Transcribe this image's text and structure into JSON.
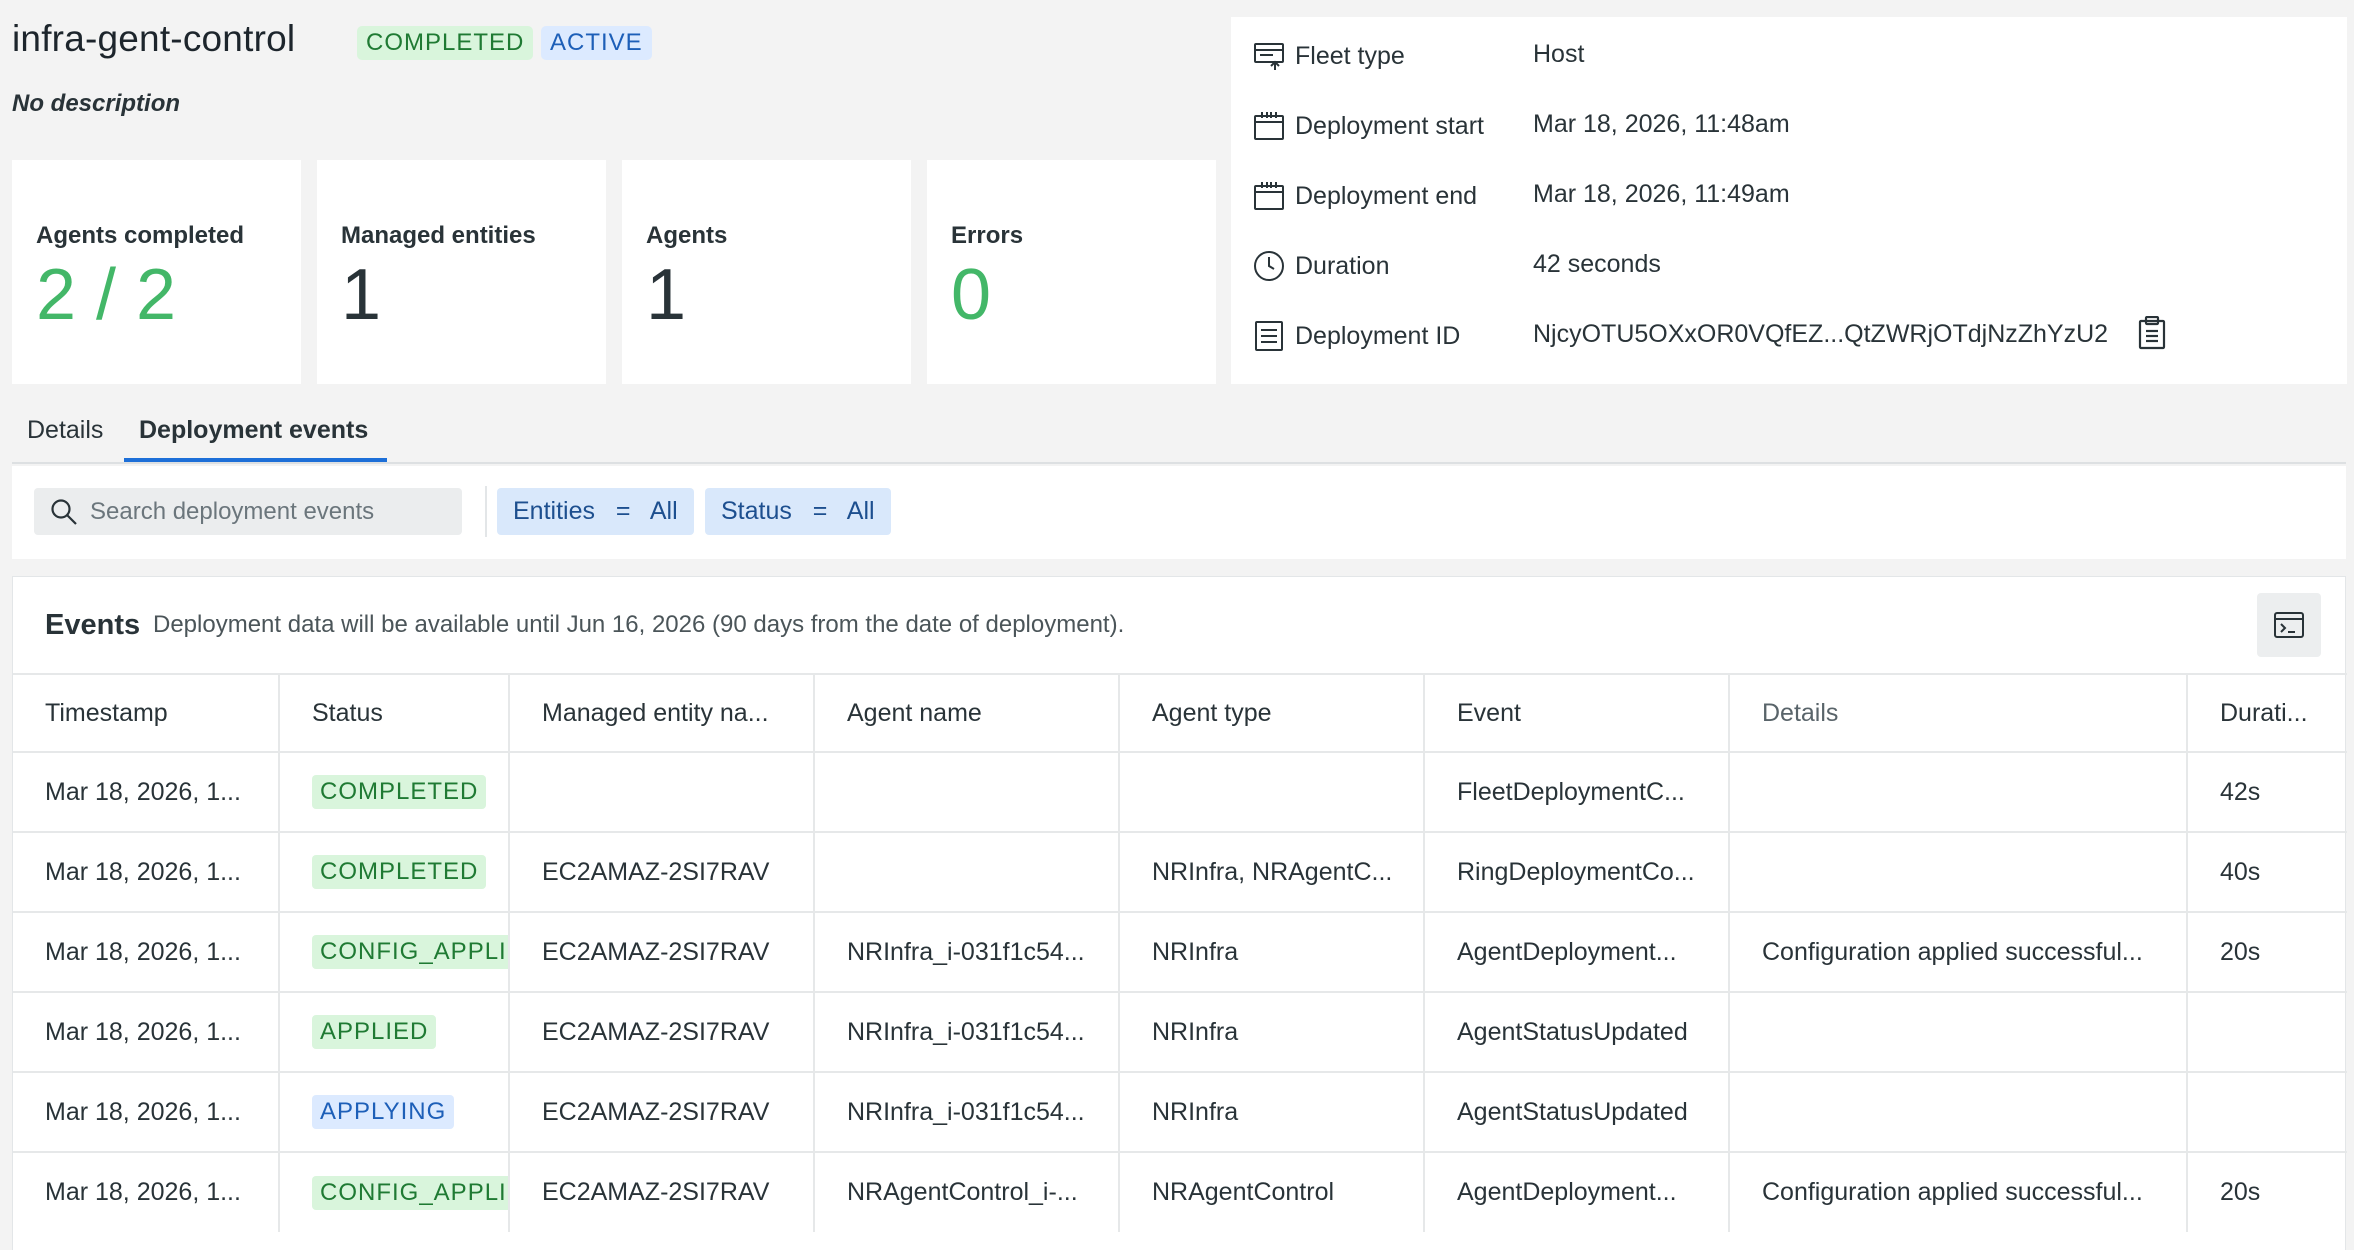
{
  "header": {
    "title": "infra-gent-control",
    "badges": [
      "COMPLETED",
      "ACTIVE"
    ],
    "description": "No description"
  },
  "stats": [
    {
      "label": "Agents completed",
      "value": "2 / 2"
    },
    {
      "label": "Managed entities",
      "value": "1"
    },
    {
      "label": "Agents",
      "value": "1"
    },
    {
      "label": "Errors",
      "value": "0"
    }
  ],
  "info": [
    {
      "icon": "fleet-icon",
      "key": "Fleet type",
      "value": "Host"
    },
    {
      "icon": "calendar-icon",
      "key": "Deployment start",
      "value": "Mar 18, 2026, 11:48am"
    },
    {
      "icon": "calendar-icon",
      "key": "Deployment end",
      "value": "Mar 18, 2026, 11:49am"
    },
    {
      "icon": "clock-icon",
      "key": "Duration",
      "value": "42 seconds"
    },
    {
      "icon": "document-icon",
      "key": "Deployment ID",
      "value": "NjcyOTU5OXxOR0VQfEZ...QtZWRjOTdjNzZhYzU2"
    }
  ],
  "tabs": [
    "Details",
    "Deployment events"
  ],
  "filters": {
    "search_placeholder": "Search deployment events",
    "entities_chip": "Entities   =   All",
    "status_chip": "Status   =   All"
  },
  "events": {
    "title": "Events",
    "note": "Deployment data will be available until Jun 16, 2026 (90 days from the date of deployment).",
    "columns": [
      "Timestamp",
      "Status",
      "Managed entity na...",
      "Agent name",
      "Agent type",
      "Event",
      "Details",
      "Durati..."
    ],
    "rows": [
      [
        "Mar 18, 2026, 1...",
        "COMPLETED",
        "",
        "",
        "",
        "FleetDeploymentC...",
        "",
        "42s"
      ],
      [
        "Mar 18, 2026, 1...",
        "COMPLETED",
        "EC2AMAZ-2SI7RAV",
        "",
        "NRInfra, NRAgentC...",
        "RingDeploymentCo...",
        "",
        "40s"
      ],
      [
        "Mar 18, 2026, 1...",
        "CONFIG_APPLIED",
        "EC2AMAZ-2SI7RAV",
        "NRInfra_i-031f1c54...",
        "NRInfra",
        "AgentDeployment...",
        "Configuration applied successful...",
        "20s"
      ],
      [
        "Mar 18, 2026, 1...",
        "APPLIED",
        "EC2AMAZ-2SI7RAV",
        "NRInfra_i-031f1c54...",
        "NRInfra",
        "AgentStatusUpdated",
        "",
        ""
      ],
      [
        "Mar 18, 2026, 1...",
        "APPLYING",
        "EC2AMAZ-2SI7RAV",
        "NRInfra_i-031f1c54...",
        "NRInfra",
        "AgentStatusUpdated",
        "",
        ""
      ],
      [
        "Mar 18, 2026, 1...",
        "CONFIG_APPLIED",
        "EC2AMAZ-2SI7RAV",
        "NRAgentControl_i-...",
        "NRAgentControl",
        "AgentDeployment...",
        "Configuration applied successful...",
        "20s"
      ]
    ]
  },
  "colors": {
    "accent": "#1d6fd8",
    "success": "#43b768"
  }
}
